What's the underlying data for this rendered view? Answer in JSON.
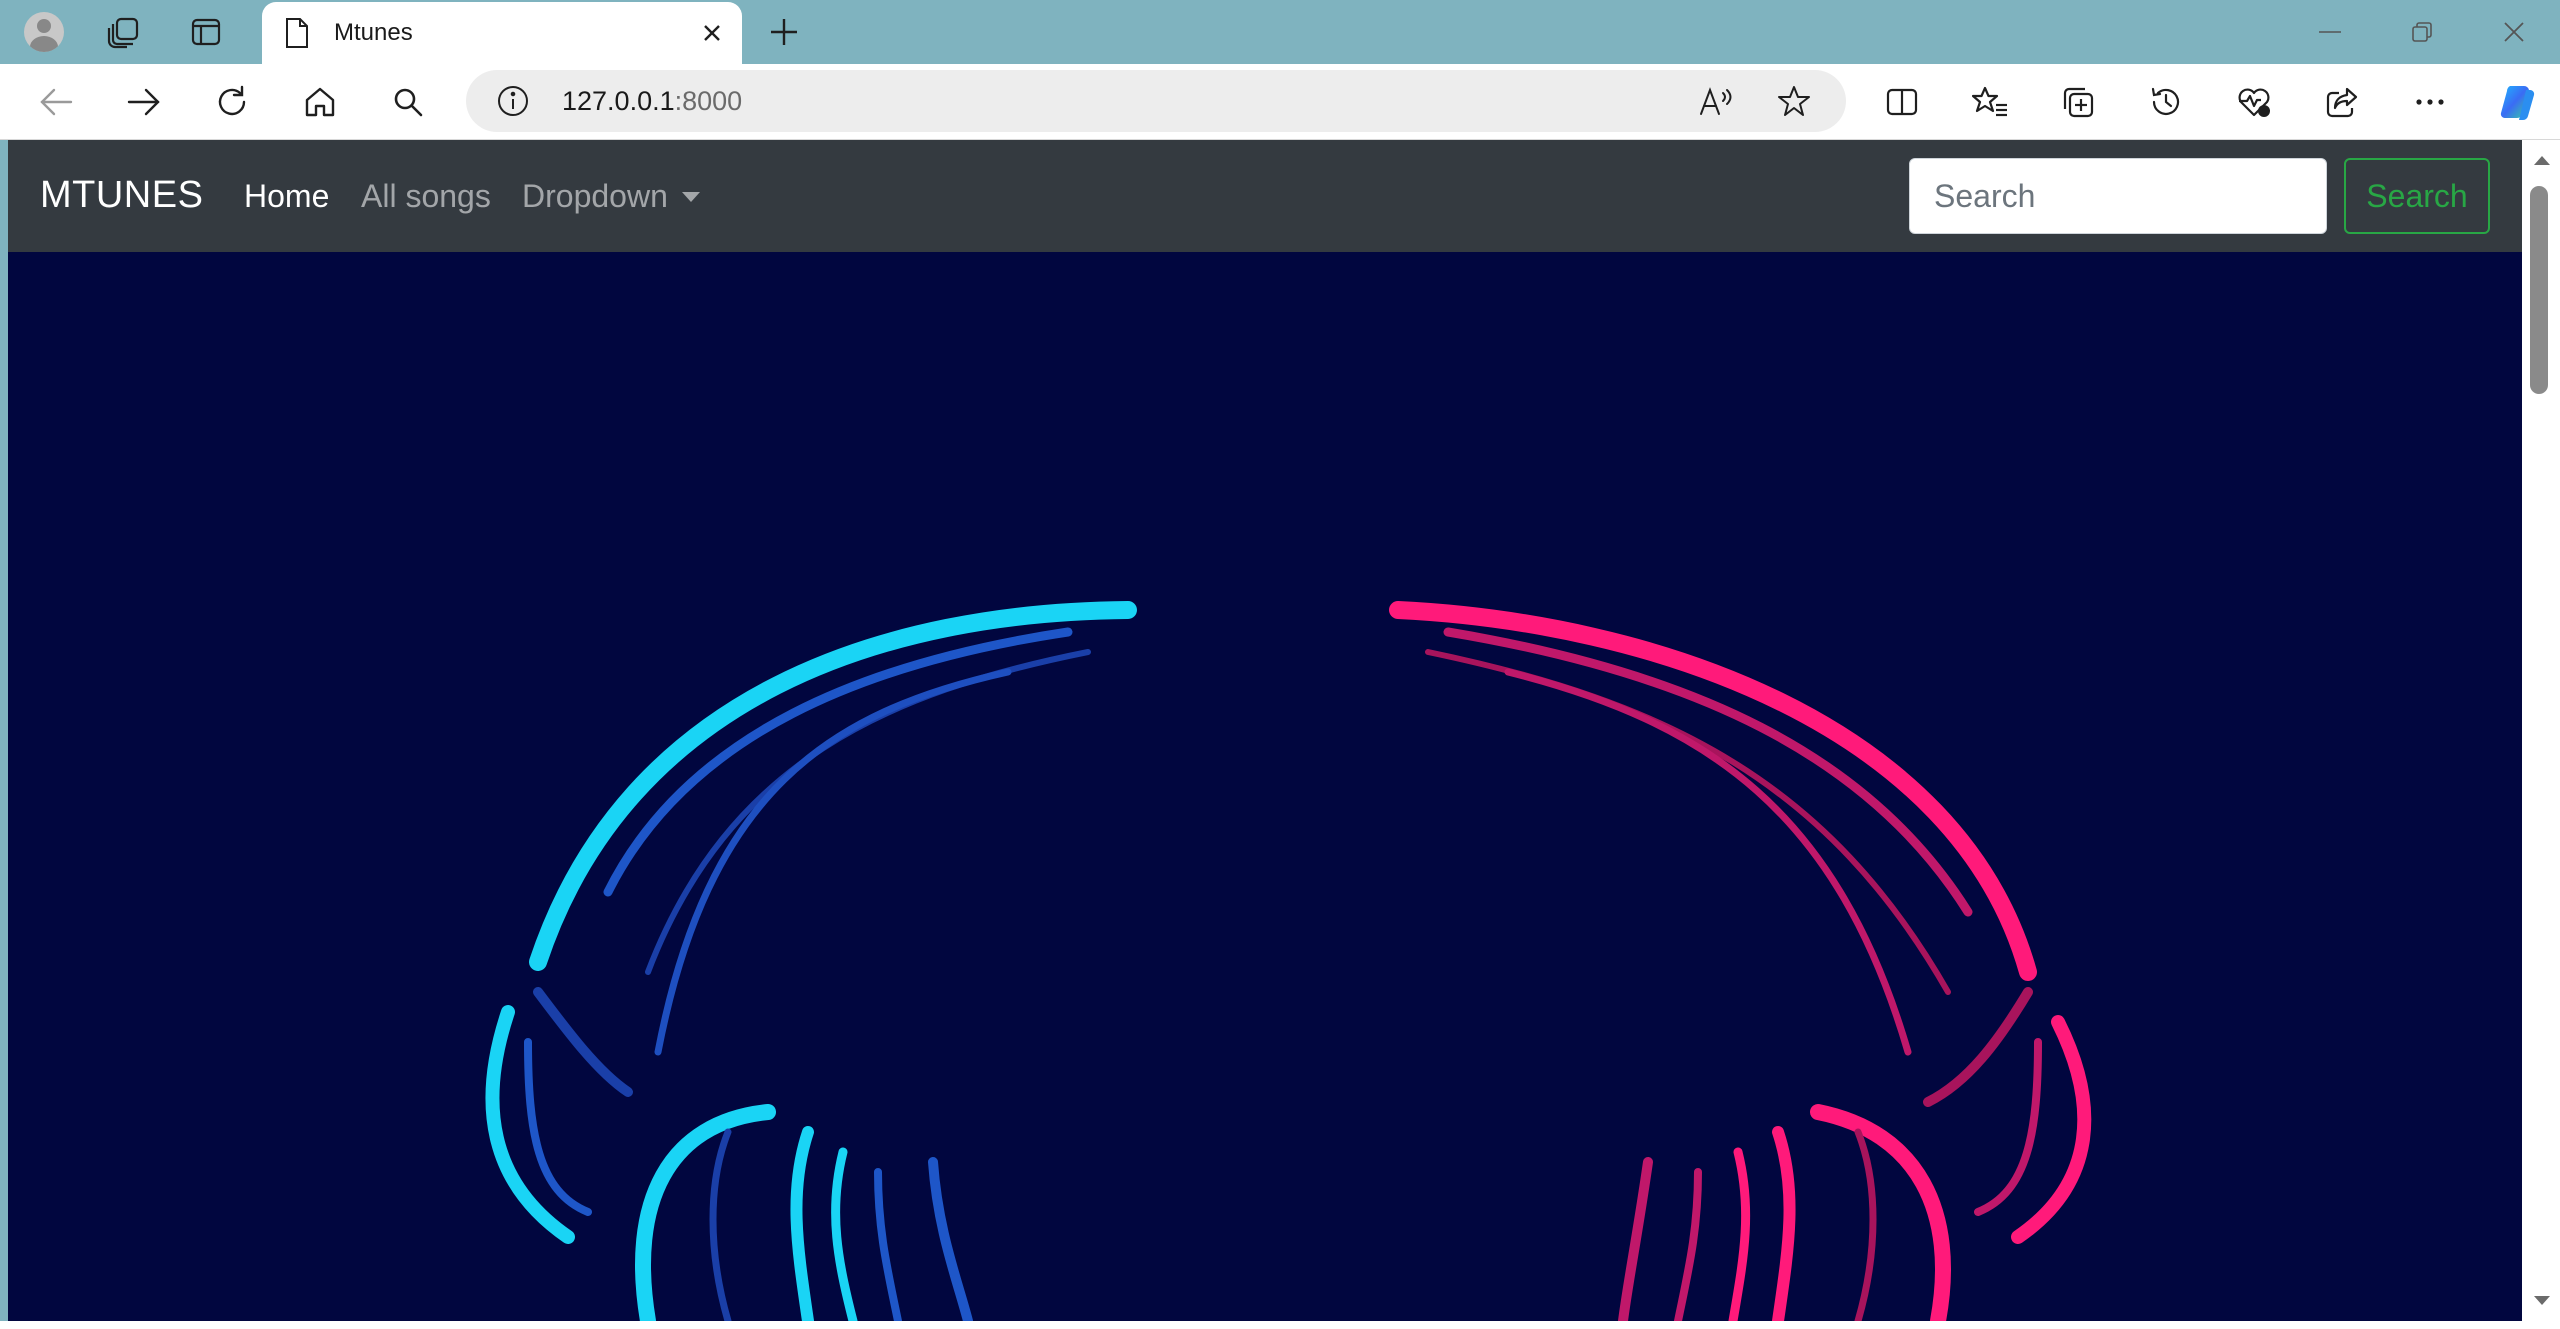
{
  "browser": {
    "tab": {
      "title": "Mtunes",
      "icon": "document-icon"
    },
    "address": {
      "host": "127.0.0.1",
      "port": ":8000"
    },
    "icons": {
      "back": "back-arrow-icon",
      "forward": "forward-arrow-icon",
      "refresh": "refresh-icon",
      "home": "home-icon",
      "search": "search-icon",
      "split_screen": "split-screen-icon",
      "favorites": "favorites-icon",
      "collections": "collections-icon",
      "history": "history-icon",
      "performance": "heart-pulse-icon",
      "share": "share-icon",
      "more": "more-icon",
      "copilot": "copilot-icon"
    }
  },
  "navbar": {
    "brand": "MTUNES",
    "links": [
      {
        "label": "Home",
        "active": true
      },
      {
        "label": "All songs",
        "active": false
      },
      {
        "label": "Dropdown",
        "active": false
      }
    ],
    "search": {
      "placeholder": "Search",
      "button_label": "Search"
    }
  },
  "hero": {
    "description_icon": "headphones-icon",
    "colors": {
      "background": "#01063f",
      "left": "#1ad4f5",
      "right": "#ff1a7a"
    }
  }
}
